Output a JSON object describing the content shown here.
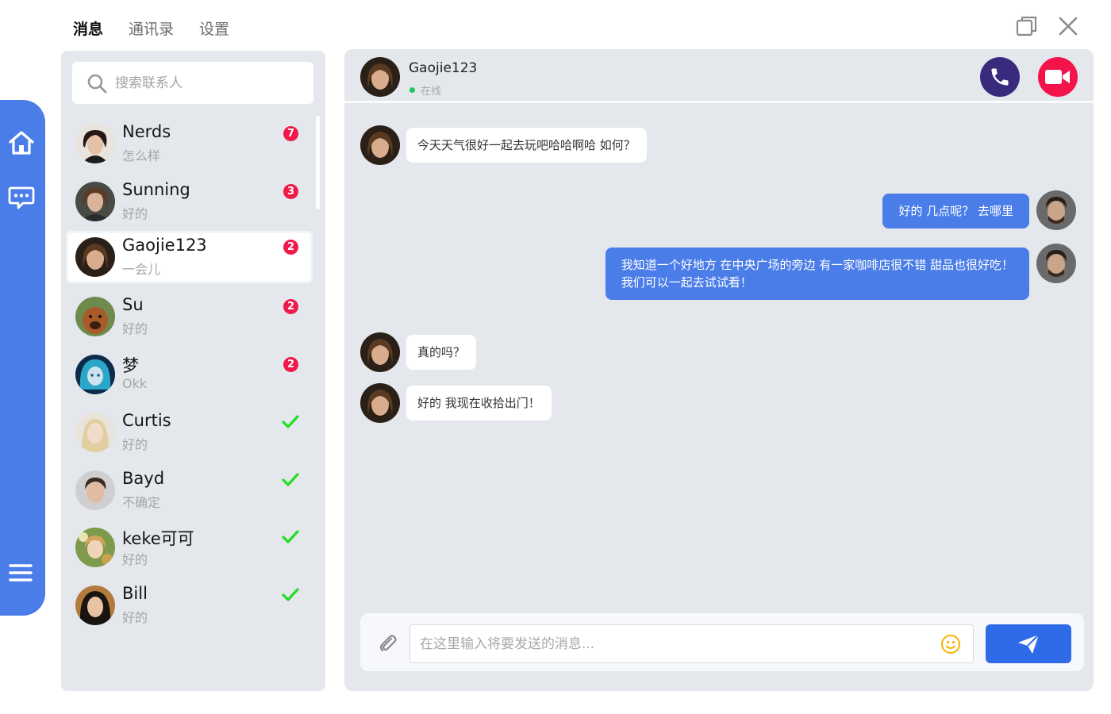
{
  "nav": {
    "tabs": [
      {
        "label": "消息",
        "active": true
      },
      {
        "label": "通讯录",
        "active": false
      },
      {
        "label": "设置",
        "active": false
      }
    ]
  },
  "colors": {
    "accent": "#4a7de8",
    "badge": "#ef1a4a",
    "online": "#22c55e",
    "voice_call": "#3a2a7e",
    "video_call": "#f2144b",
    "check": "#22dd22"
  },
  "rail": {
    "icons": [
      "home-icon",
      "chat-icon",
      "menu-icon"
    ]
  },
  "search": {
    "placeholder": "搜索联系人"
  },
  "contacts": [
    {
      "name": "Nerds",
      "preview": "怎么样",
      "unread": "7",
      "status": "unread"
    },
    {
      "name": "Sunning",
      "preview": "好的",
      "unread": "3",
      "status": "unread"
    },
    {
      "name": "Gaojie123",
      "preview": "一会儿",
      "unread": "2",
      "status": "unread",
      "selected": true
    },
    {
      "name": "Su",
      "preview": "好的",
      "unread": "2",
      "status": "unread"
    },
    {
      "name": "梦",
      "preview": "Okk",
      "unread": "2",
      "status": "unread"
    },
    {
      "name": "Curtis",
      "preview": "好的",
      "status": "read"
    },
    {
      "name": "Bayd",
      "preview": "不确定",
      "status": "read"
    },
    {
      "name": "keke可可",
      "preview": "好的",
      "status": "read"
    },
    {
      "name": "Bill",
      "preview": "好的",
      "status": "read"
    }
  ],
  "chat": {
    "title": "Gaojie123",
    "status": "在线",
    "messages": [
      {
        "from": "them",
        "text": "今天天气很好一起去玩吧哈哈啊哈  如何？"
      },
      {
        "from": "me",
        "text": "好的  几点呢？ 去哪里"
      },
      {
        "from": "me",
        "text": "我知道一个好地方  在中央广场的旁边  有一家咖啡店很不错  甜品也很好吃！",
        "text2": "我们可以一起去试试看！"
      },
      {
        "from": "them",
        "text": "真的吗？"
      },
      {
        "from": "them",
        "text": "好的  我现在收拾出门！"
      }
    ]
  },
  "composer": {
    "placeholder": "在这里输入将要发送的消息..."
  }
}
